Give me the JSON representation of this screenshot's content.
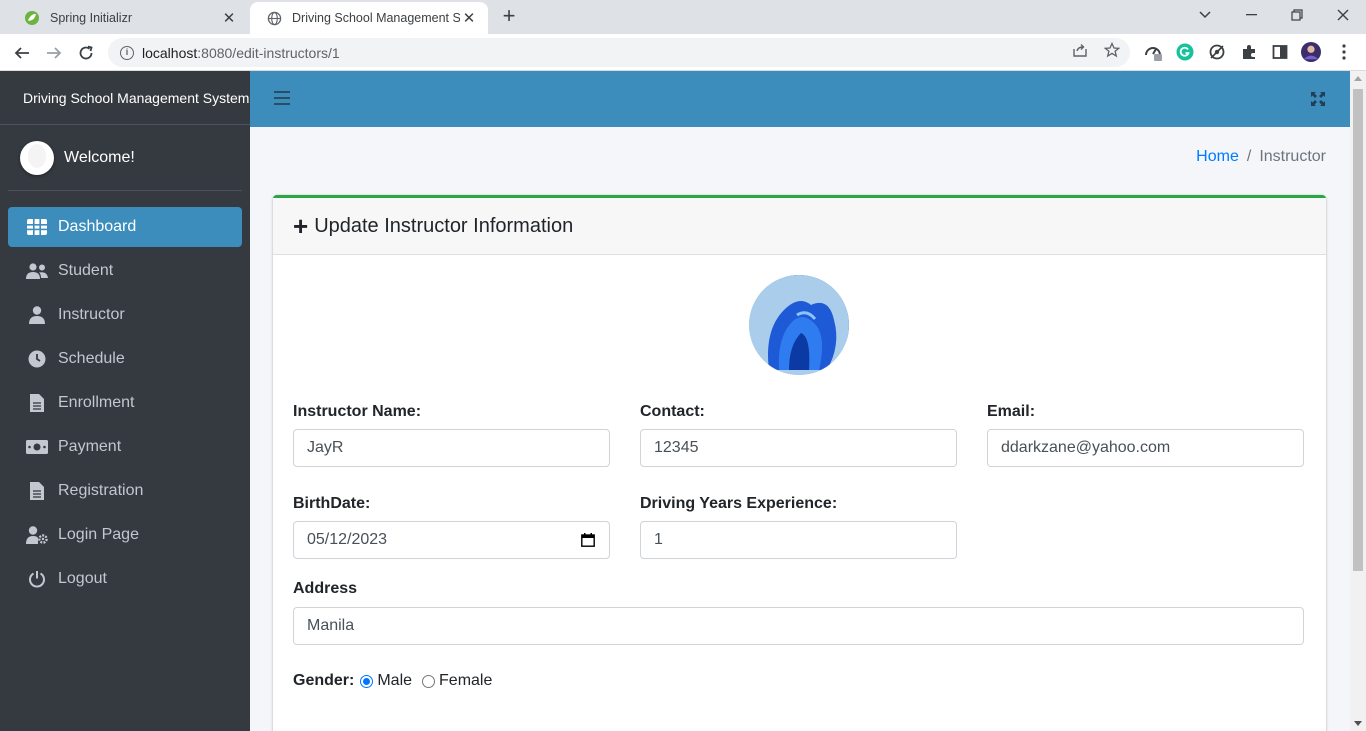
{
  "browser": {
    "tabs": [
      {
        "title": "Spring Initializr",
        "active": false
      },
      {
        "title": "Driving School Management System",
        "active": true
      }
    ],
    "url_host": "localhost",
    "url_path": ":8080/edit-instructors/1"
  },
  "sidebar": {
    "brand": "Driving School Management System",
    "welcome": "Welcome!",
    "items": [
      {
        "label": "Dashboard",
        "icon": "grid-icon"
      },
      {
        "label": "Student",
        "icon": "users-icon"
      },
      {
        "label": "Instructor",
        "icon": "user-icon"
      },
      {
        "label": "Schedule",
        "icon": "clock-icon"
      },
      {
        "label": "Enrollment",
        "icon": "file-icon"
      },
      {
        "label": "Payment",
        "icon": "money-icon"
      },
      {
        "label": "Registration",
        "icon": "file-icon"
      },
      {
        "label": "Login Page",
        "icon": "user-gear-icon"
      },
      {
        "label": "Logout",
        "icon": "power-icon"
      }
    ],
    "active_index": 0
  },
  "breadcrumb": {
    "home": "Home",
    "separator": "/",
    "current": "Instructor"
  },
  "card": {
    "title": "Update Instructor Information",
    "accent_color": "#28a745"
  },
  "form": {
    "instructor_name": {
      "label": "Instructor Name:",
      "value": "JayR"
    },
    "contact": {
      "label": "Contact:",
      "value": "12345"
    },
    "email": {
      "label": "Email:",
      "value": "ddarkzane@yahoo.com"
    },
    "birthdate": {
      "label": "BirthDate:",
      "value": "05/12/2023"
    },
    "experience": {
      "label": "Driving Years Experience:",
      "value": "1"
    },
    "address": {
      "label": "Address",
      "value": "Manila"
    },
    "gender": {
      "label": "Gender:",
      "options": [
        "Male",
        "Female"
      ],
      "selected": "Male"
    }
  },
  "colors": {
    "primary": "#3c8dbc",
    "sidebar": "#343a40",
    "link": "#007bff"
  }
}
